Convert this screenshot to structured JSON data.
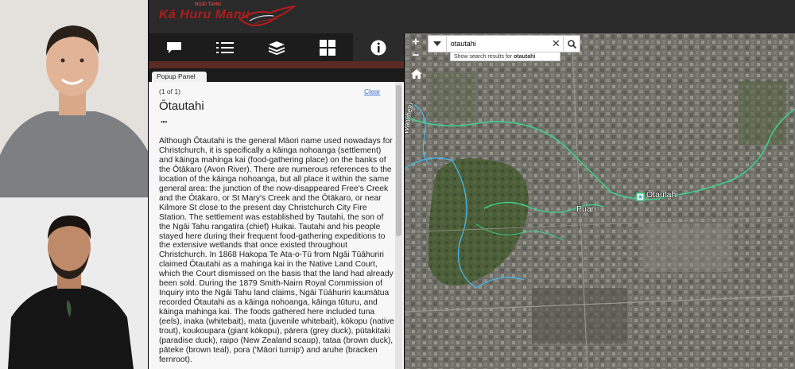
{
  "app": {
    "title": "Kā Huru Manu",
    "subtitle": "NGĀI TAHU"
  },
  "toolbar": {
    "tools": [
      {
        "icon": "chat-bubble-icon"
      },
      {
        "icon": "list-icon"
      },
      {
        "icon": "layers-icon"
      },
      {
        "icon": "grid-icon"
      },
      {
        "icon": "info-icon",
        "active": true
      }
    ]
  },
  "popup": {
    "tab_label": "Popup Panel",
    "count": "(1 of 1)",
    "clear_label": "Clear",
    "title": "Ōtautahi",
    "dash": "\"\"",
    "description": "Although Ōtautahi is the general Māori name used nowadays for Christchurch, it is specifically a kāinga nohoanga (settlement) and kāinga mahinga kai (food-gathering place) on the banks of the Ōtākaro (Avon River). There are numerous references to the location of the kāinga nohoanga, but all place it within the same general area: the junction of the now-disappeared Free's Creek and the Ōtākaro, or St Mary's Creek and the Ōtākaro, or near Kilmore St close to the present day Christchurch City Fire Station. The settlement was established by Tautahi, the son of the Ngāi Tahu rangatira (chief) Huikai. Tautahi and his people stayed here during their frequent food-gathering expeditions to the extensive wetlands that once existed throughout Christchurch. In 1868 Hakopa Te Ata-o-Tū from Ngāi Tūāhuriri claimed Ōtautahi as a mahinga kai in the Native Land Court, which the Court dismissed on the basis that the land had already been sold. During the 1879 Smith-Nairn Royal Commission of Inquiry into the Ngāi Tahu land claims, Ngāi Tūāhuriri kaumātua recorded Ōtautahi as a kāinga nohoanga, kāinga tūturu, and kāinga mahinga kai. The foods gathered here included tuna (eels), inaka (whitebait), mata (juvenile whitebait), kōkopu (native trout), koukoupara (giant kōkopu), pārera (grey duck), pūtakitaki (paradise duck), raipo (New Zealand scaup), tataa (brown duck), pāteke (brown teal), pora ('Māori turnip') and aruhe (bracken fernroot)."
  },
  "map": {
    "search_value": "otautahi",
    "suggestion_prefix": "Show search results for ",
    "suggestion_term": "otautahi",
    "zoom_in": "+",
    "zoom_out": "−",
    "labels": {
      "otautahi": "Ōtautahi",
      "puari": "Puari",
      "waiwhetu": "Waiwhetu"
    }
  },
  "colors": {
    "brand_red": "#b31b1b",
    "header_bg": "#2a2a2a",
    "river_line": "#3fd08a"
  }
}
